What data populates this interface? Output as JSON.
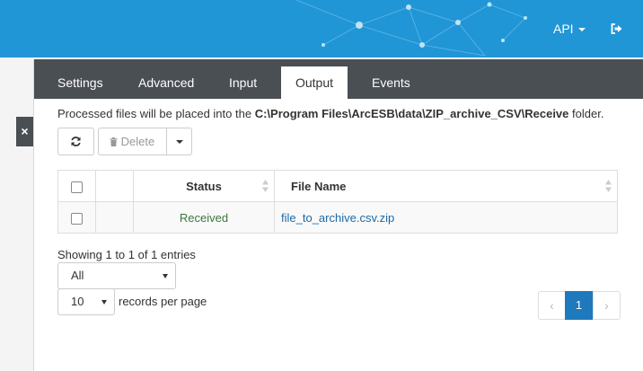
{
  "header": {
    "api_label": "API",
    "bg_color": "#2196d6",
    "logout_icon": "sign-out-icon"
  },
  "sidebar": {
    "close_label": "×"
  },
  "tabs": [
    {
      "label": "Settings"
    },
    {
      "label": "Advanced"
    },
    {
      "label": "Input"
    },
    {
      "label": "Output",
      "active": true
    },
    {
      "label": "Events"
    }
  ],
  "info": {
    "prefix": "Processed files will be placed into the",
    "path": "C:\\Program Files\\ArcESB\\data\\ZIP_archive_CSV\\Receive",
    "suffix": "folder."
  },
  "toolbar": {
    "refresh_icon": "refresh-icon",
    "delete_label": "Delete",
    "delete_icon": "trash-icon"
  },
  "table": {
    "columns": [
      "Status",
      "File Name"
    ],
    "rows": [
      {
        "status": "Received",
        "file_name": "file_to_archive.csv.zip"
      }
    ]
  },
  "footer": {
    "showing": "Showing 1 to 1 of 1 entries",
    "filter_value": "All",
    "records_per_page_value": "10",
    "records_per_page_label": "records per page"
  },
  "pagination": {
    "prev": "‹",
    "current": "1",
    "next": "›",
    "accent": "#1f79bd"
  }
}
